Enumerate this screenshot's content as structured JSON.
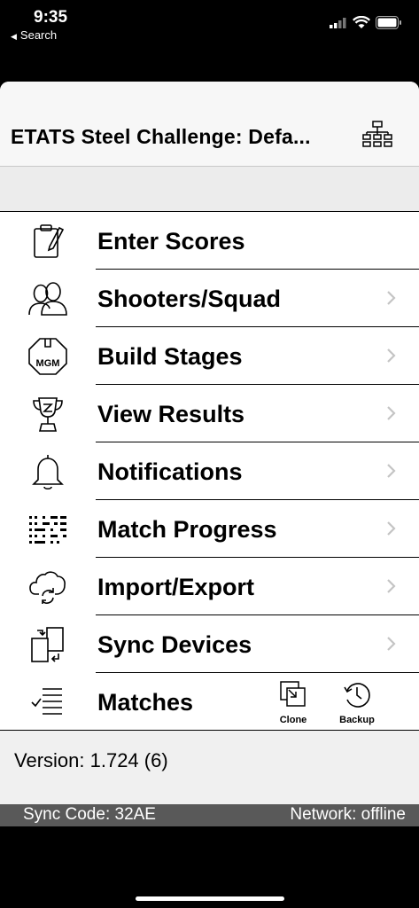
{
  "status_bar": {
    "time": "9:35",
    "back_label": "Search"
  },
  "navbar": {
    "title": "ETATS Steel Challenge: Defa..."
  },
  "menu": [
    {
      "label": "Enter Scores",
      "icon": "clipboard-pencil-icon",
      "chevron": false
    },
    {
      "label": "Shooters/Squad",
      "icon": "users-icon",
      "chevron": true
    },
    {
      "label": "Build Stages",
      "icon": "mgm-target-icon",
      "chevron": true
    },
    {
      "label": "View Results",
      "icon": "trophy-icon",
      "chevron": true
    },
    {
      "label": "Notifications",
      "icon": "bell-icon",
      "chevron": true
    },
    {
      "label": "Match Progress",
      "icon": "progress-grid-icon",
      "chevron": true
    },
    {
      "label": "Import/Export",
      "icon": "cloud-sync-icon",
      "chevron": true
    },
    {
      "label": "Sync Devices",
      "icon": "devices-sync-icon",
      "chevron": true
    },
    {
      "label": "Matches",
      "icon": "checklist-icon",
      "chevron": false
    }
  ],
  "matches_tools": {
    "clone_label": "Clone",
    "backup_label": "Backup"
  },
  "icon_text": {
    "mgm": "MGM"
  },
  "footer": {
    "version": "Version: 1.724 (6)",
    "sync_code": "Sync Code: 32AE",
    "network": "Network: offline"
  }
}
